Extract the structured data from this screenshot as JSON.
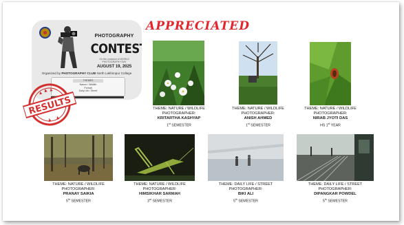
{
  "poster": {
    "title_small": "PHOTOGRAPHY",
    "title_big": "CONTEST",
    "subtitle": "On the occasion of WORLD PHOTOGRAPHY DAY",
    "date": "AUGUST 19, 2025",
    "organizer_prefix": "Organized by",
    "organizer_club": "PHOTOGRAPHY CLUB",
    "organizer_college": "North Lakhimpur College",
    "box_header": "THEMES",
    "box_lines": [
      "Nature / Wildlife",
      "Portrait",
      "Daily Life / Street"
    ]
  },
  "stamp": {
    "text": "RESULTS",
    "color": "#d32f2f"
  },
  "heading": {
    "text": "APPRECIATED",
    "color": "#e2262b"
  },
  "entries": [
    {
      "theme": "THEME: NATURE / WILDLIFE",
      "role": "PHOTOGRAPHER:",
      "name": "KRITARTHA KASHYAP",
      "sem_num": "1",
      "sem_sup": "st",
      "sem_word": "SEMESTER"
    },
    {
      "theme": "THEME: NATURE / WILDLIFE",
      "role": "PHOTOGRAPHER:",
      "name": "ANISH AHMED",
      "sem_num": "1",
      "sem_sup": "st",
      "sem_word": "SEMESTER"
    },
    {
      "theme": "THEME: NATURE / WILDLIFE",
      "role": "PHOTOGRAPHER:",
      "name": "NIRAB JYOTI DAS",
      "sem_num": "HS 1",
      "sem_sup": "st",
      "sem_word": "YEAR"
    },
    {
      "theme": "THEME: NATURE / WILDLIFE",
      "role": "PHOTOGRAPHER:",
      "name": "PRANAY SAIKIA",
      "sem_num": "5",
      "sem_sup": "th",
      "sem_word": "SEMESTER"
    },
    {
      "theme": "THEME: NATURE / WILDLIFE",
      "role": "PHOTOGRAPHER:",
      "name": "HIMSIKHAR SARMAH",
      "sem_num": "3",
      "sem_sup": "rd",
      "sem_word": "SEMESTER"
    },
    {
      "theme": "THEME: DAILY LIFE / STREET",
      "role": "PHOTOGRAPHER:",
      "name": "BIKI ALI",
      "sem_num": "5",
      "sem_sup": "th",
      "sem_word": "SEMESTER"
    },
    {
      "theme": "THEME: DAILY LIFE / STREET",
      "role": "PHOTOGRAPHER:",
      "name": "DIPANGKAR POWDEL",
      "sem_num": "5",
      "sem_sup": "th",
      "sem_word": "SEMESTER"
    }
  ]
}
